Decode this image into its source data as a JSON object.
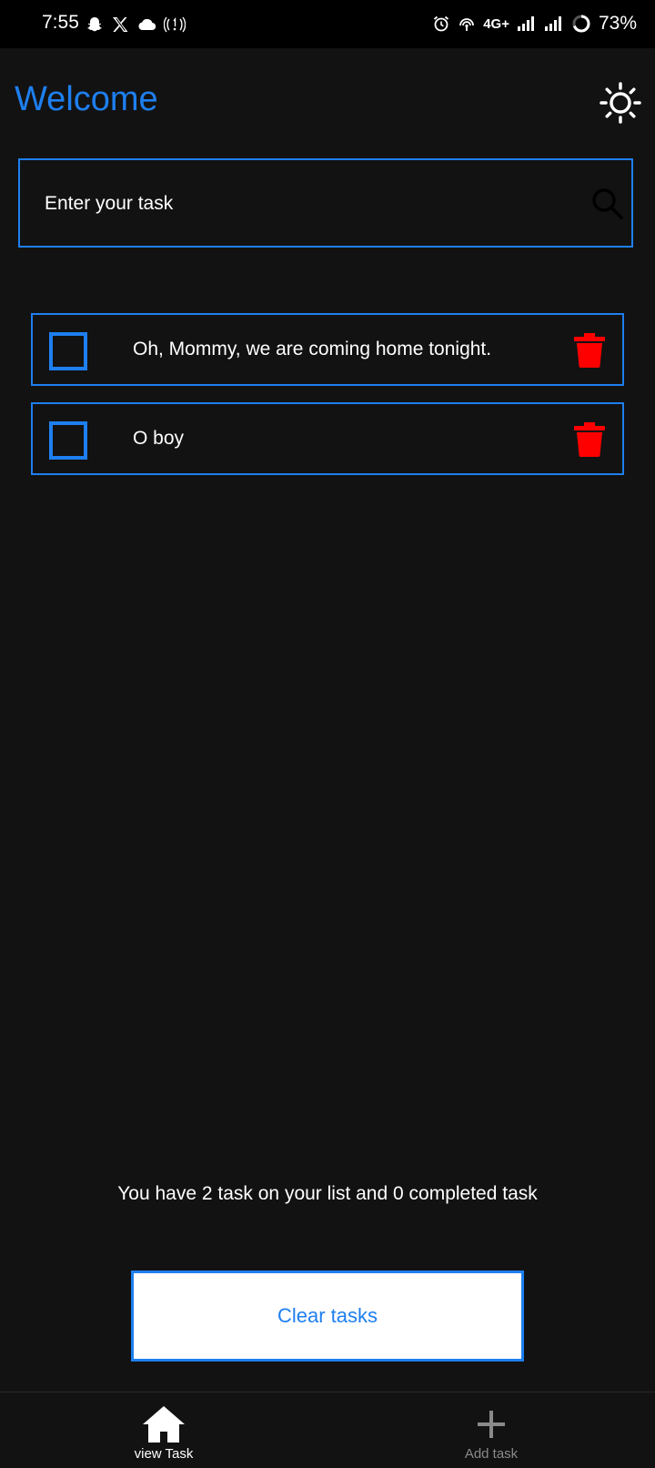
{
  "status_bar": {
    "time": "7:55",
    "network": "4G+",
    "battery": "73%"
  },
  "header": {
    "title": "Welcome",
    "theme_icon": "sun-icon"
  },
  "search": {
    "placeholder": "Enter your task",
    "value": ""
  },
  "tasks": [
    {
      "label": "Oh, Mommy, we are coming home tonight.",
      "completed": false
    },
    {
      "label": "O boy",
      "completed": false
    }
  ],
  "summary": {
    "prefix": "You have ",
    "task_count": "2",
    "middle": " task on your list and ",
    "completed_count": "0",
    "suffix": " completed task"
  },
  "clear_button": {
    "label": "Clear tasks"
  },
  "bottom_nav": {
    "items": [
      {
        "label": "view Task",
        "icon": "home-icon",
        "active": true
      },
      {
        "label": "Add task",
        "icon": "plus-icon",
        "active": false
      }
    ]
  },
  "colors": {
    "accent": "#1e7ff0",
    "background": "#121212",
    "delete": "#ff0000",
    "inactive_nav": "#8a8a8a"
  }
}
